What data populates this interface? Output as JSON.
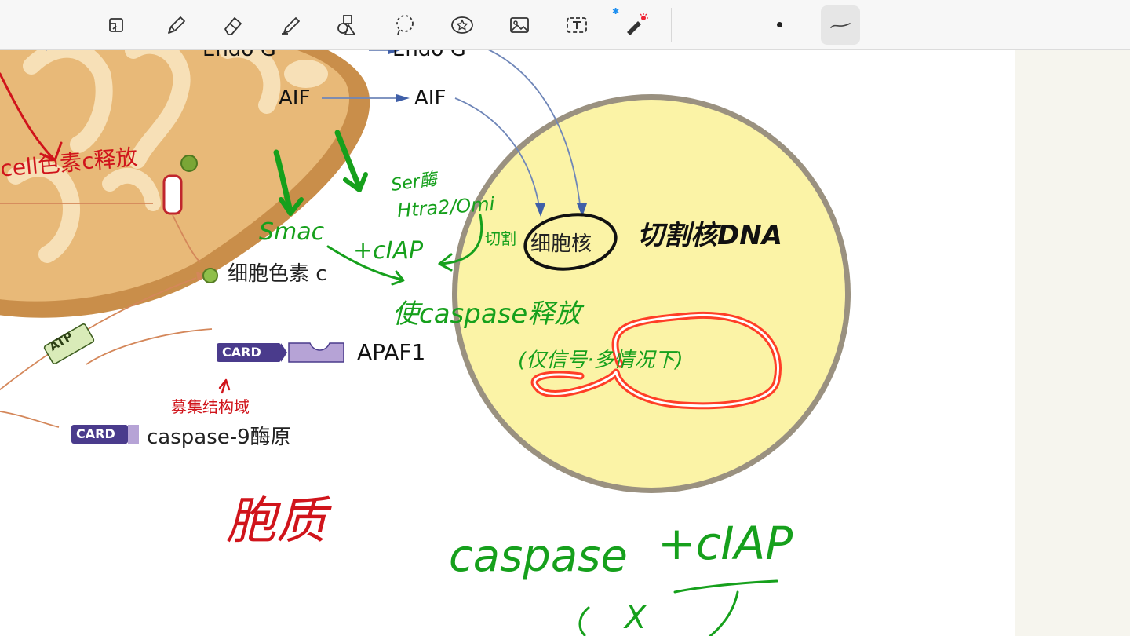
{
  "toolbar": {
    "tools": [
      {
        "name": "Page layout",
        "icon": "page-layout-icon"
      },
      {
        "name": "Pen",
        "icon": "pen-icon"
      },
      {
        "name": "Eraser",
        "icon": "eraser-icon"
      },
      {
        "name": "Highlighter",
        "icon": "highlighter-icon"
      },
      {
        "name": "Shapes",
        "icon": "shapes-icon"
      },
      {
        "name": "Lasso",
        "icon": "lasso-icon"
      },
      {
        "name": "Sticker",
        "icon": "sticker-icon"
      },
      {
        "name": "Image",
        "icon": "image-icon"
      },
      {
        "name": "Text",
        "icon": "text-box-icon"
      },
      {
        "name": "Laser pointer",
        "icon": "laser-pointer-icon"
      },
      {
        "name": "Stroke size",
        "icon": "dot-icon"
      },
      {
        "name": "Stroke style",
        "icon": "stroke-style-icon"
      }
    ],
    "bluetooth_glyph": "✱",
    "accent": "#1e8ff0"
  },
  "diagram": {
    "endo_g_left": "Endo G",
    "endo_g_right": "Endo G",
    "aif_left": "AIF",
    "aif_right": "AIF",
    "cytochrome_c": "细胞色素 c",
    "atp": "ATP",
    "card_apaf": "CARD",
    "apaf1": "APAF1",
    "card_caspase": "CARD",
    "caspase9": "caspase-9酶原"
  },
  "notes": {
    "cell_cyt_release": "cell色素c释放",
    "smac": "Smac",
    "ser_enzyme": "Ser酶",
    "htra2": "Htra2/Omi",
    "ciap_mid": "+cIAP",
    "cleave": "切割",
    "nucleus": "细胞核",
    "cleave_dna": "切割核DNA",
    "caspase_release": "使caspase释放",
    "only_signal": "(仅信号·多情况下)",
    "recruit": "募集结构域",
    "cytoplasm": "胞质",
    "caspase_bottom": "caspase",
    "ciap_bottom": "+cIAP",
    "x_mark": "X"
  },
  "colors": {
    "green_ink": "#16a01c",
    "red_ink": "#d0141b",
    "black_ink": "#111111",
    "nucleus_fill": "#fbf3a6",
    "mito": "#d9a35e",
    "card": "#4a3b8c"
  }
}
